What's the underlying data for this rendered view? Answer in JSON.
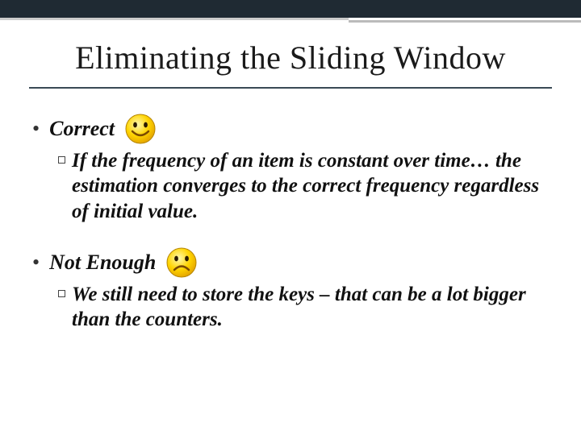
{
  "title": "Eliminating the Sliding Window",
  "points": [
    {
      "label": "Correct",
      "icon": "smile",
      "sub": "If the frequency of an item is constant over time… the estimation converges to the correct frequency regardless of initial value."
    },
    {
      "label": "Not Enough",
      "icon": "frown",
      "sub": "We still need to store the keys – that can be a lot bigger than the counters."
    }
  ]
}
